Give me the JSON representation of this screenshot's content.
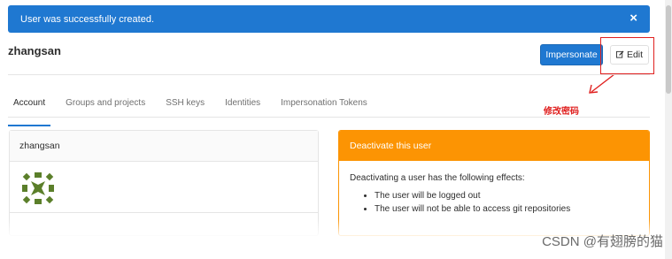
{
  "flash": {
    "message": "User was successfully created.",
    "close_symbol": "×"
  },
  "user": {
    "name": "zhangsan"
  },
  "header_actions": {
    "impersonate_label": "Impersonate",
    "edit_label": "Edit"
  },
  "annotation": {
    "text": "修改密码",
    "color": "#e0201f"
  },
  "tabs": [
    {
      "label": "Account",
      "active": true
    },
    {
      "label": "Groups and projects"
    },
    {
      "label": "SSH keys"
    },
    {
      "label": "Identities"
    },
    {
      "label": "Impersonation Tokens"
    }
  ],
  "profile_card": {
    "title": "zhangsan",
    "avatar_icon": "identicon-avatar"
  },
  "deactivate_card": {
    "title": "Deactivate this user",
    "intro": "Deactivating a user has the following effects:",
    "effects": [
      "The user will be logged out",
      "The user will not be able to access git repositories"
    ]
  },
  "watermark": "CSDN @有翅膀的猫",
  "colors": {
    "primary": "#1f78d1",
    "warning": "#fc9403"
  }
}
